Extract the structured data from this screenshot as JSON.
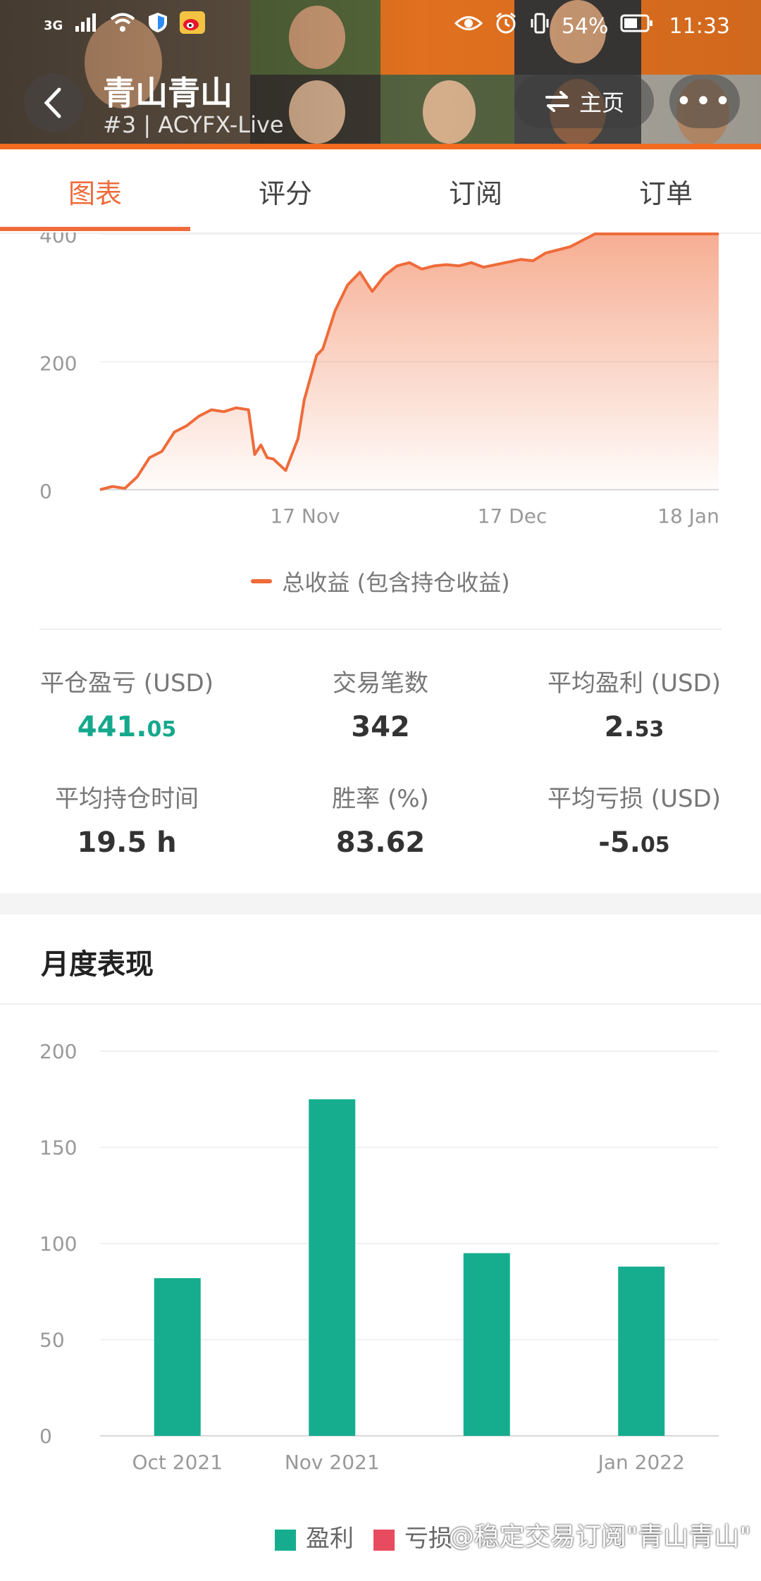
{
  "status_bar": {
    "network": "3G",
    "battery": "54%",
    "time": "11:33"
  },
  "header": {
    "title": "青山青山",
    "subtitle": "#3 | ACYFX-Live",
    "home_label": "主页",
    "more_label": "•••"
  },
  "tabs": [
    {
      "label": "图表",
      "active": true
    },
    {
      "label": "评分",
      "active": false
    },
    {
      "label": "订阅",
      "active": false
    },
    {
      "label": "订单",
      "active": false
    }
  ],
  "colors": {
    "accent": "#ef6b3a",
    "profit": "#16ad8f",
    "loss": "#e84b5f",
    "header_bg": "#f06a1f"
  },
  "chart_data": [
    {
      "type": "area",
      "series": [
        {
          "name": "总收益 (包含持仓收益)",
          "x": [
            0,
            2,
            4,
            6,
            8,
            10,
            12,
            14,
            16,
            18,
            20,
            22,
            24,
            25,
            26,
            27,
            28,
            30,
            32,
            33,
            34,
            35,
            36,
            38,
            40,
            42,
            44,
            46,
            48,
            50,
            52,
            54,
            56,
            58,
            60,
            62,
            64,
            66,
            68,
            70,
            72,
            74,
            76,
            78,
            80,
            82,
            84,
            86,
            88,
            90,
            92,
            94,
            96,
            98,
            100
          ],
          "values": [
            0,
            5,
            2,
            20,
            50,
            60,
            90,
            100,
            115,
            125,
            122,
            128,
            125,
            55,
            70,
            50,
            48,
            30,
            80,
            140,
            175,
            210,
            220,
            280,
            320,
            340,
            310,
            335,
            350,
            355,
            345,
            350,
            352,
            350,
            355,
            348,
            352,
            356,
            360,
            358,
            370,
            375,
            380,
            390,
            400,
            400,
            400,
            400,
            400,
            400,
            400,
            400,
            400,
            400,
            400
          ]
        }
      ],
      "x_tick_labels": [
        "17 Nov",
        "17 Dec",
        "18 Jan"
      ],
      "y_ticks": [
        0,
        200,
        400
      ],
      "ylim": [
        0,
        400
      ],
      "legend": "bottom-center",
      "grid": true
    },
    {
      "type": "bar",
      "categories": [
        "Oct 2021",
        "Nov 2021",
        "",
        "Jan 2022"
      ],
      "series": [
        {
          "name": "盈利",
          "values": [
            82,
            175,
            95,
            88
          ]
        },
        {
          "name": "亏损",
          "values": [
            0,
            0,
            0,
            0
          ]
        }
      ],
      "y_ticks": [
        0,
        50,
        100,
        150,
        200
      ],
      "ylim": [
        0,
        200
      ],
      "legend": "bottom-center",
      "grid": true
    }
  ],
  "stats": {
    "closed_pnl": {
      "label": "平仓盈亏 (USD)",
      "int": "441.",
      "dec": "05"
    },
    "trades": {
      "label": "交易笔数",
      "value": "342"
    },
    "avg_profit": {
      "label": "平均盈利 (USD)",
      "int": "2.",
      "dec": "53"
    },
    "avg_hold": {
      "label": "平均持仓时间",
      "value": "19.5 h"
    },
    "win_rate": {
      "label": "胜率 (%)",
      "value": "83.62"
    },
    "avg_loss": {
      "label": "平均亏损 (USD)",
      "int": "-5.",
      "dec": "05"
    }
  },
  "monthly": {
    "title": "月度表现"
  },
  "watermark": "@稳定交易订阅\"青山青山\""
}
